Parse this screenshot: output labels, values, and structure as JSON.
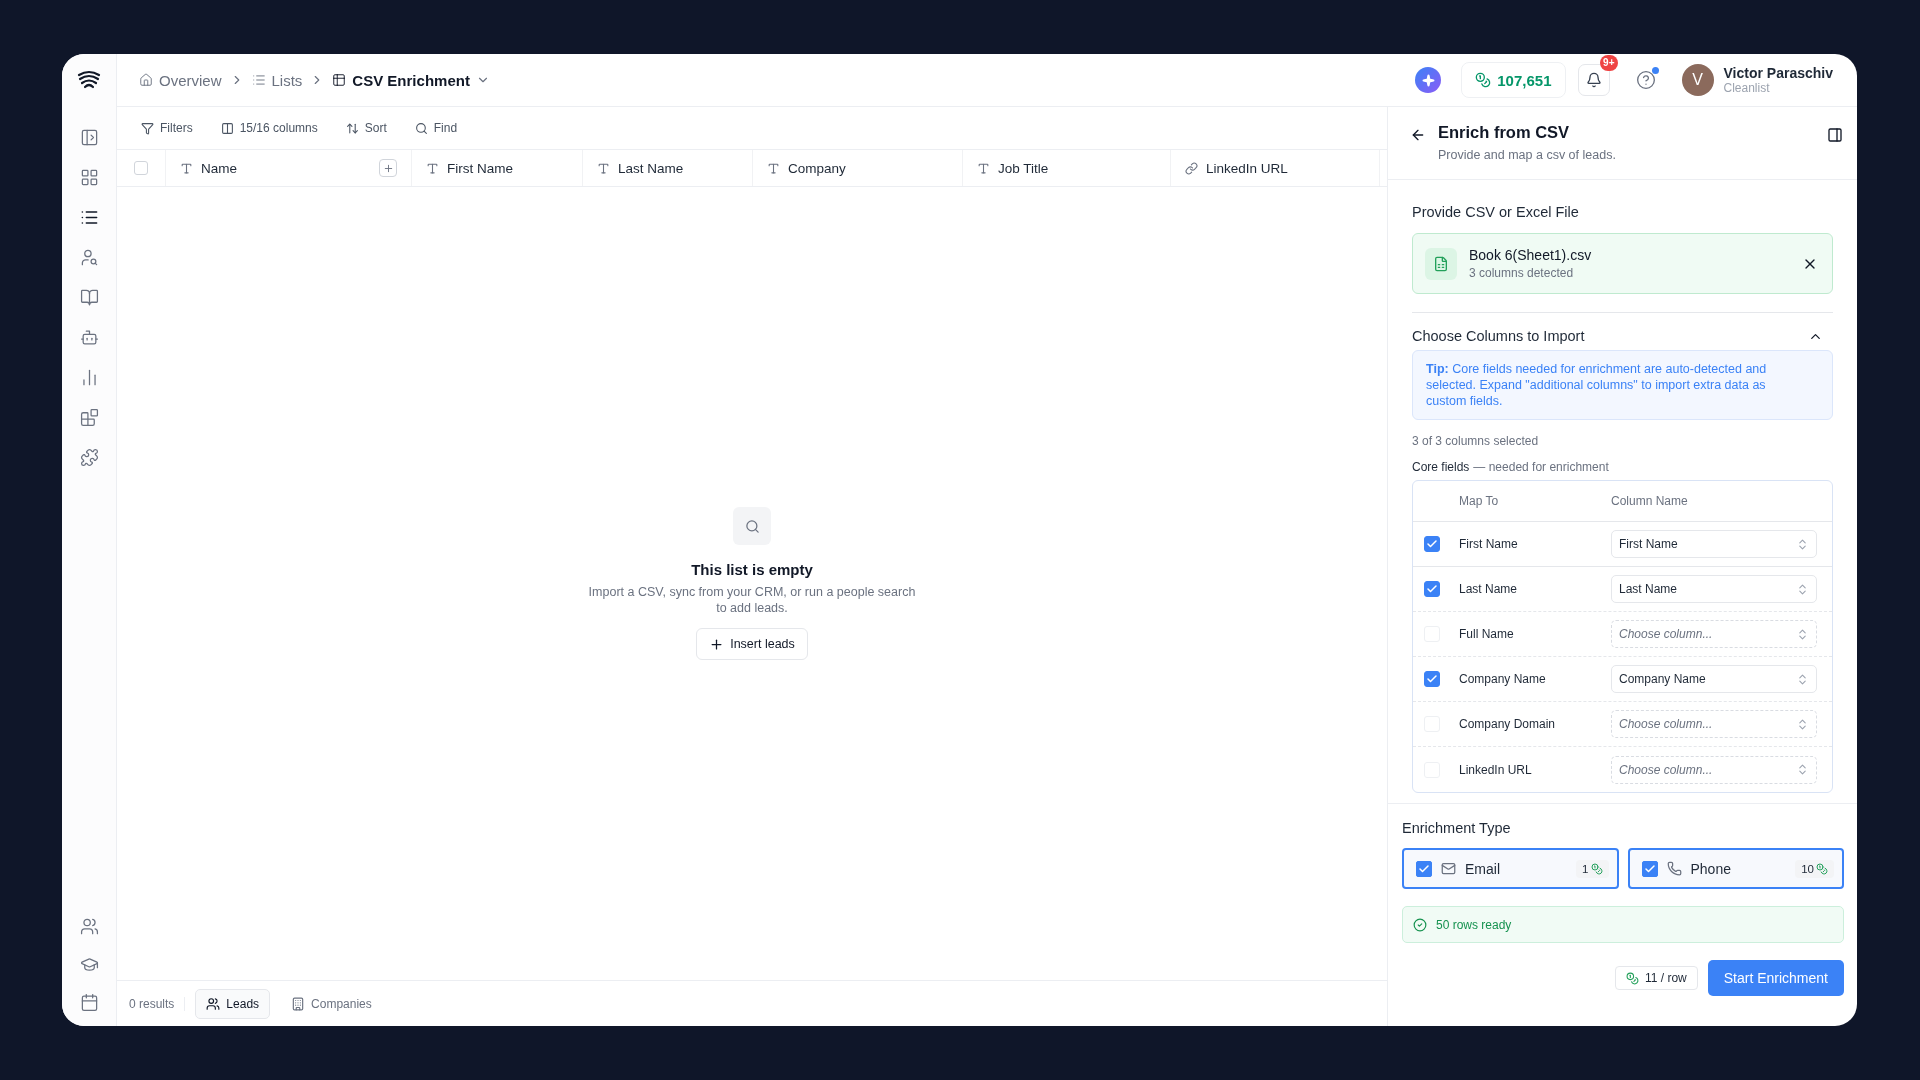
{
  "breadcrumbs": [
    {
      "label": "Overview",
      "kind": "home"
    },
    {
      "label": "Lists",
      "kind": "list"
    },
    {
      "label": "CSV Enrichment",
      "kind": "table"
    }
  ],
  "header": {
    "credits": "107,651",
    "notifications": "9+",
    "help_unread": true,
    "user": {
      "initial": "V",
      "name": "Victor Paraschiv",
      "org": "Cleanlist"
    }
  },
  "sidebar": {
    "items": [
      {
        "selected": false
      },
      {
        "selected": false
      },
      {
        "selected": true
      },
      {
        "selected": false
      },
      {
        "selected": false
      },
      {
        "selected": false
      },
      {
        "selected": false
      },
      {
        "selected": false
      },
      {
        "selected": false
      }
    ],
    "bottom_items": [
      {
        "selected": false
      },
      {
        "selected": false
      },
      {
        "selected": false
      }
    ]
  },
  "toolbar": [
    "Filters",
    "15/16 columns",
    "Sort",
    "Find"
  ],
  "table": {
    "select_all": false,
    "columns": [
      {
        "label": "Name",
        "kind": "text"
      },
      {
        "label": "First Name",
        "kind": "text"
      },
      {
        "label": "Last Name",
        "kind": "text"
      },
      {
        "label": "Company",
        "kind": "text"
      },
      {
        "label": "Job Title",
        "kind": "text"
      },
      {
        "label": "LinkedIn URL",
        "kind": "link"
      }
    ]
  },
  "empty_state": {
    "title": "This list is empty",
    "text": "Import a CSV, sync from your CRM, or run a people search to add leads.",
    "button": "Insert leads"
  },
  "footer": {
    "results": "0 results",
    "tabs": [
      {
        "label": "Leads",
        "selected": true
      },
      {
        "label": "Companies",
        "selected": false
      }
    ]
  },
  "panel": {
    "title": "Enrich from CSV",
    "subtitle": "Provide and map a csv of leads.",
    "file_section": {
      "heading": "Provide CSV or Excel File",
      "file_name": "Book 6(Sheet1).csv",
      "file_meta": "3 columns detected"
    },
    "columns_section": {
      "heading": "Choose Columns to Import",
      "expanded": true,
      "tip": "**Tip:** Core fields needed for enrichment are auto-detected and selected. Expand \"additional columns\" to import extra data as custom fields.",
      "count": "3 of 3 columns selected",
      "core_label": "Core fields",
      "core_hint": "— needed for enrichment"
    },
    "mapping": {
      "headers": [
        "Map To",
        "Column Name"
      ],
      "rows": [
        {
          "field": "First Name",
          "checked": true,
          "value": "First Name"
        },
        {
          "field": "Last Name",
          "checked": true,
          "value": "Last Name"
        },
        {
          "field": "Full Name",
          "checked": false,
          "placeholder": "Choose column..."
        },
        {
          "field": "Company Name",
          "checked": true,
          "value": "Company Name"
        },
        {
          "field": "Company Domain",
          "checked": false,
          "placeholder": "Choose column..."
        },
        {
          "field": "LinkedIn URL",
          "checked": false,
          "placeholder": "Choose column..."
        }
      ]
    },
    "enrichment": {
      "heading": "Enrichment Type",
      "options": [
        {
          "kind": "email",
          "label": "Email",
          "cost": "1",
          "checked": true
        },
        {
          "kind": "phone",
          "label": "Phone",
          "cost": "10",
          "checked": true
        }
      ],
      "ready": "50 rows ready",
      "per_row": "11 / row",
      "button": "Start Enrichment"
    }
  }
}
